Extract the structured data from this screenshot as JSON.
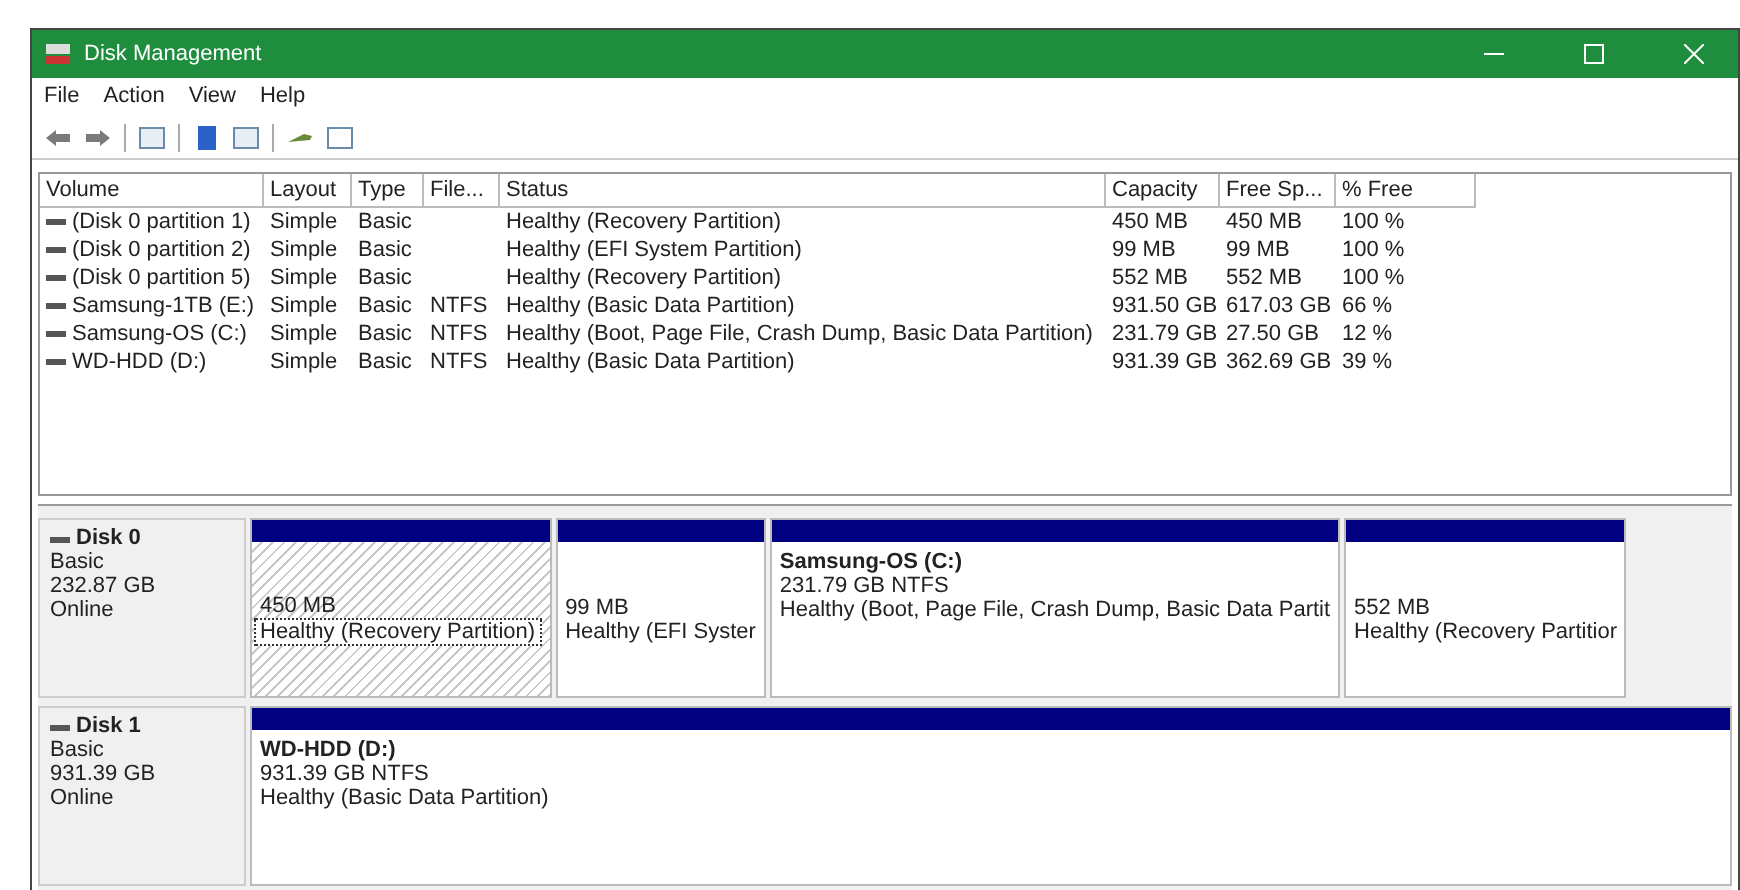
{
  "window": {
    "title": "Disk Management"
  },
  "menu": [
    "File",
    "Action",
    "View",
    "Help"
  ],
  "table": {
    "columns": [
      "Volume",
      "Layout",
      "Type",
      "File...",
      "Status",
      "Capacity",
      "Free Sp...",
      "% Free"
    ],
    "rows": [
      [
        "(Disk 0 partition 1)",
        "Simple",
        "Basic",
        "",
        "Healthy (Recovery Partition)",
        "450 MB",
        "450 MB",
        "100 %"
      ],
      [
        "(Disk 0 partition 2)",
        "Simple",
        "Basic",
        "",
        "Healthy (EFI System Partition)",
        "99 MB",
        "99 MB",
        "100 %"
      ],
      [
        "(Disk 0 partition 5)",
        "Simple",
        "Basic",
        "",
        "Healthy (Recovery Partition)",
        "552 MB",
        "552 MB",
        "100 %"
      ],
      [
        "Samsung-1TB (E:)",
        "Simple",
        "Basic",
        "NTFS",
        "Healthy (Basic Data Partition)",
        "931.50 GB",
        "617.03 GB",
        "66 %"
      ],
      [
        "Samsung-OS (C:)",
        "Simple",
        "Basic",
        "NTFS",
        "Healthy (Boot, Page File, Crash Dump, Basic Data Partition)",
        "231.79 GB",
        "27.50 GB",
        "12 %"
      ],
      [
        "WD-HDD (D:)",
        "Simple",
        "Basic",
        "NTFS",
        "Healthy (Basic Data Partition)",
        "931.39 GB",
        "362.69 GB",
        "39 %"
      ]
    ]
  },
  "disks": [
    {
      "name": "Disk 0",
      "type": "Basic",
      "size": "232.87 GB",
      "state": "Online",
      "partitions": [
        {
          "size": "450 MB",
          "status": "Healthy (Recovery Partition)",
          "selected": true
        },
        {
          "size": "99 MB",
          "status": "Healthy (EFI Syster",
          "selected": false
        },
        {
          "name": "Samsung-OS  (C:)",
          "size": "231.79 GB NTFS",
          "status": "Healthy (Boot, Page File, Crash Dump, Basic Data Partit",
          "selected": false
        },
        {
          "size": "552 MB",
          "status": "Healthy (Recovery Partitior",
          "selected": false
        }
      ]
    },
    {
      "name": "Disk 1",
      "type": "Basic",
      "size": "931.39 GB",
      "state": "Online",
      "partitions": [
        {
          "name": "WD-HDD  (D:)",
          "size": "931.39 GB NTFS",
          "status": "Healthy (Basic Data Partition)",
          "selected": false
        }
      ]
    }
  ]
}
